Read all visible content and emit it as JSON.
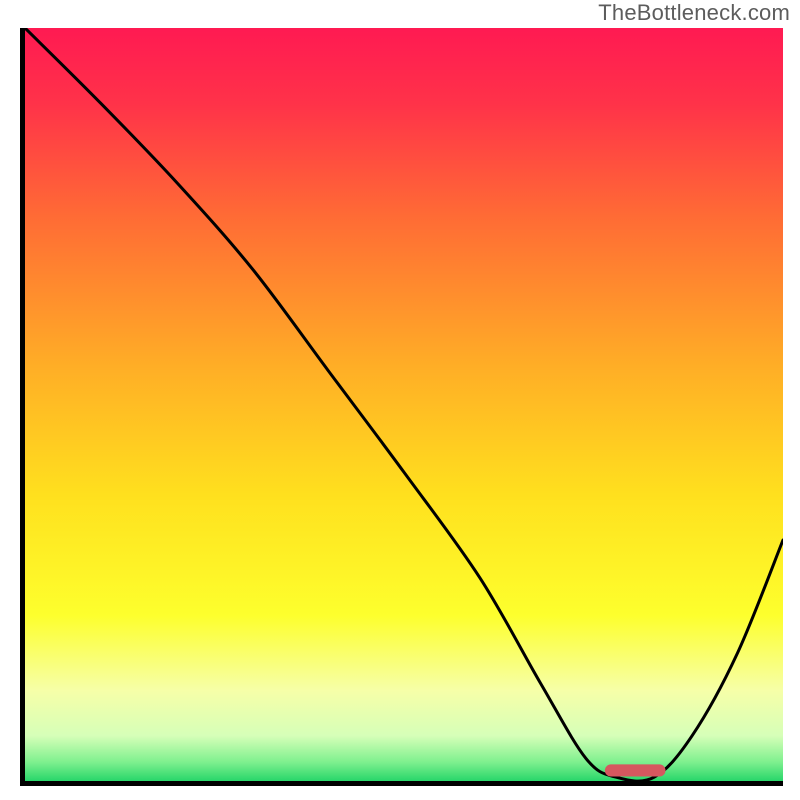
{
  "watermark": "TheBottleneck.com",
  "chart_data": {
    "type": "line",
    "title": "",
    "xlabel": "",
    "ylabel": "",
    "xlim": [
      0,
      100
    ],
    "ylim": [
      0,
      100
    ],
    "grid": false,
    "background_gradient": {
      "type": "vertical",
      "stops": [
        {
          "pos": 0.0,
          "color": "#ff1a52"
        },
        {
          "pos": 0.1,
          "color": "#ff3249"
        },
        {
          "pos": 0.25,
          "color": "#ff6b35"
        },
        {
          "pos": 0.45,
          "color": "#ffae26"
        },
        {
          "pos": 0.62,
          "color": "#ffe01e"
        },
        {
          "pos": 0.78,
          "color": "#fdff2d"
        },
        {
          "pos": 0.88,
          "color": "#f6ffa8"
        },
        {
          "pos": 0.94,
          "color": "#d6ffb8"
        },
        {
          "pos": 0.975,
          "color": "#7ef08e"
        },
        {
          "pos": 1.0,
          "color": "#28d66a"
        }
      ]
    },
    "series": [
      {
        "name": "bottleneck-curve",
        "color": "#000000",
        "width": 3,
        "x": [
          0,
          10,
          20,
          30,
          40,
          50,
          60,
          68,
          74,
          78,
          83,
          88,
          94,
          100
        ],
        "y": [
          100,
          90,
          79.5,
          68,
          54.5,
          41,
          27,
          13,
          3,
          0.5,
          0.5,
          6,
          17,
          32
        ]
      }
    ],
    "markers": [
      {
        "name": "optimal-marker",
        "shape": "rounded-bar",
        "color": "#d6575f",
        "x_center": 80.5,
        "y_center": 1.4,
        "width": 8,
        "height": 1.6
      }
    ]
  }
}
